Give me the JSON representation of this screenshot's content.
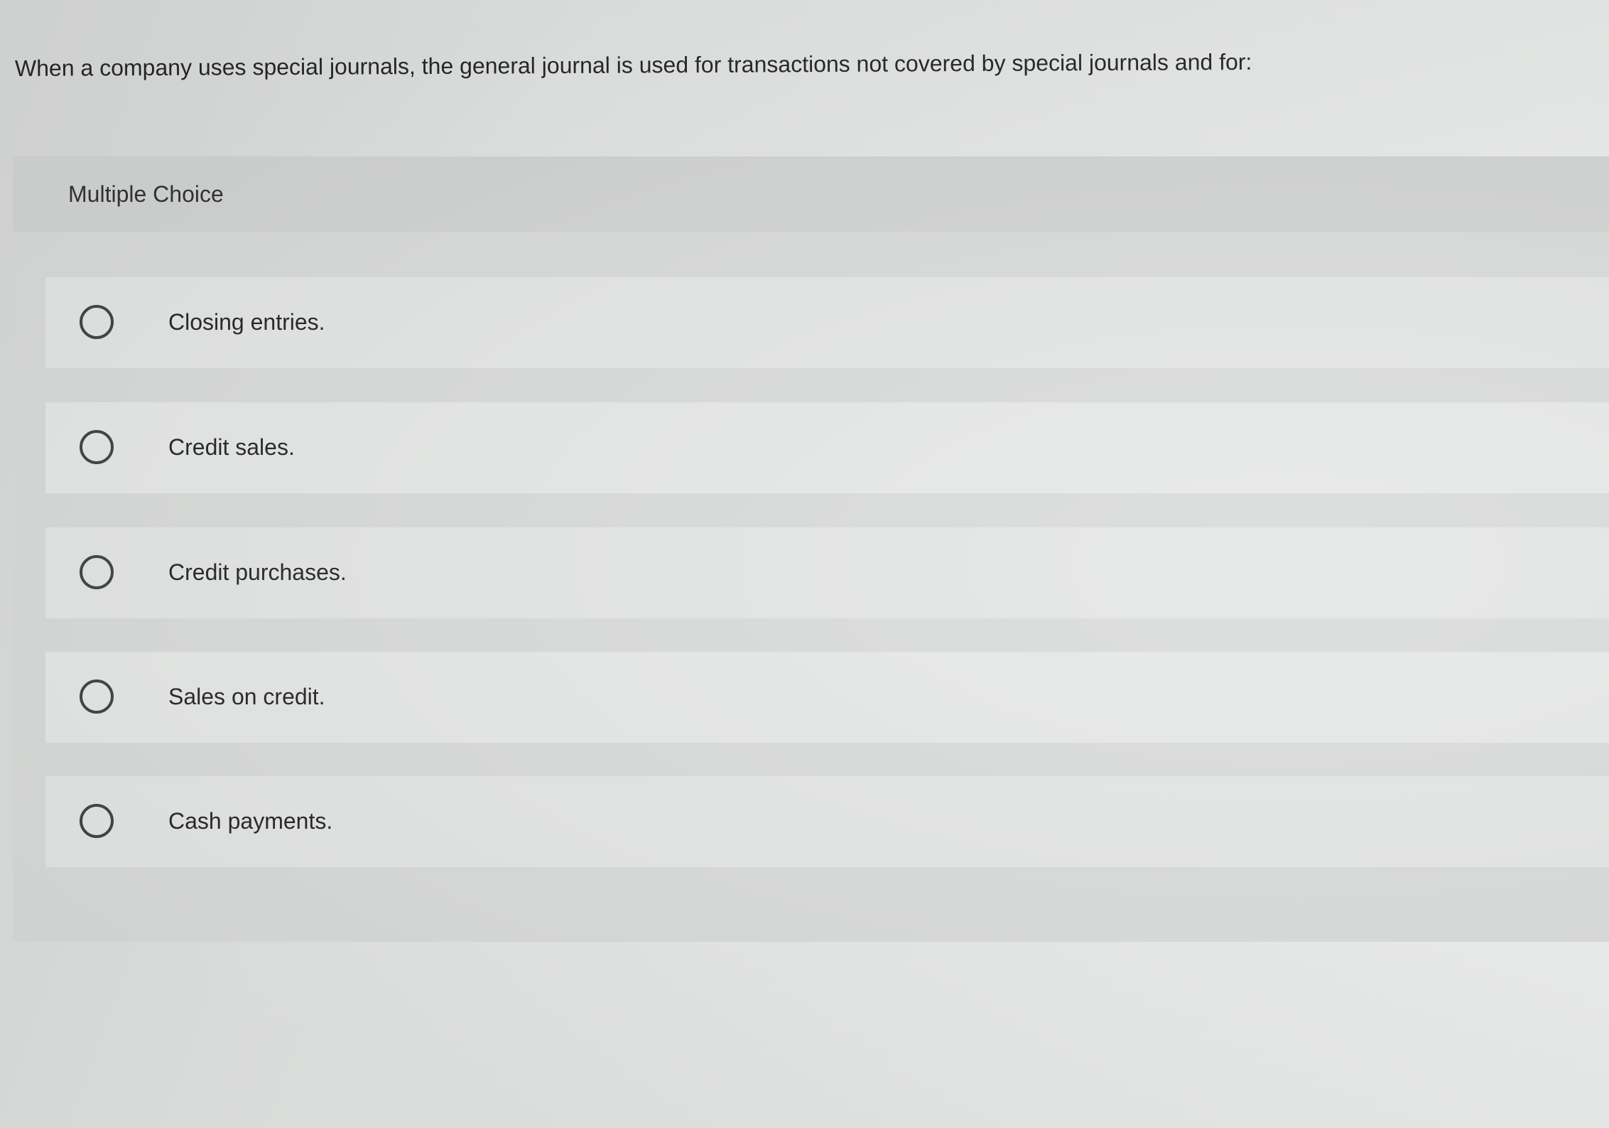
{
  "question": {
    "text": "When a company uses special journals, the general journal is used for transactions not covered by special journals and for:"
  },
  "multiple_choice": {
    "header_label": "Multiple Choice",
    "options": [
      {
        "label": "Closing entries.",
        "selected": false
      },
      {
        "label": "Credit sales.",
        "selected": false
      },
      {
        "label": "Credit purchases.",
        "selected": false
      },
      {
        "label": "Sales on credit.",
        "selected": false
      },
      {
        "label": "Cash payments.",
        "selected": false
      }
    ]
  },
  "icons": {
    "radio": "radio-unchecked-icon"
  },
  "colors": {
    "background": "#e2e4e3",
    "panel": "#d9dbda",
    "option_row": "#e5e7e6",
    "radio_border": "#3f4444",
    "text": "#262626"
  }
}
